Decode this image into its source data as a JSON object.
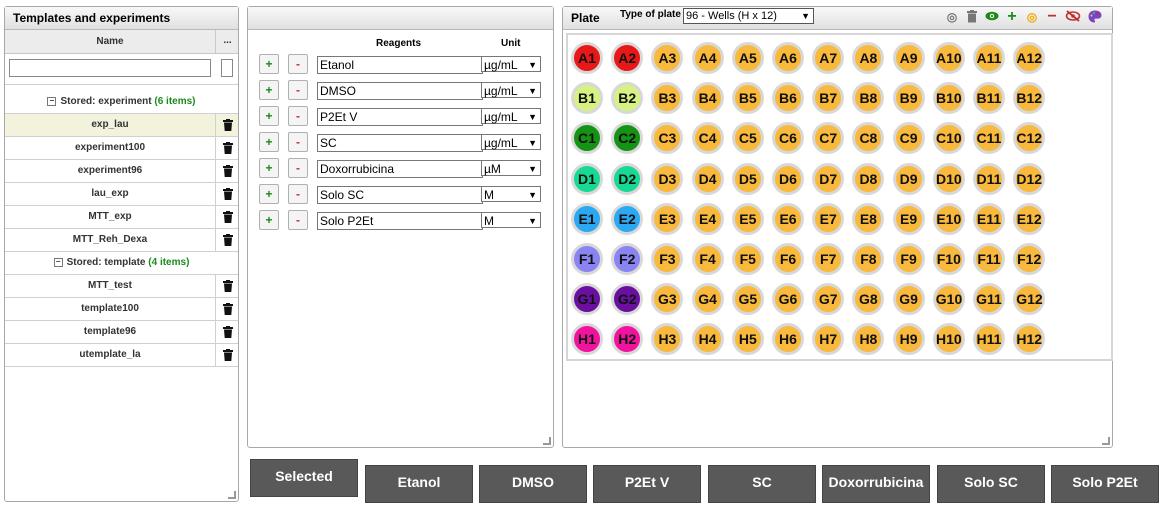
{
  "left_panel": {
    "title": "Templates and experiments",
    "column_name": "Name",
    "column_more": "...",
    "groups": [
      {
        "label": "Stored: experiment",
        "count": "(6 items)",
        "items": [
          "exp_lau",
          "experiment100",
          "experiment96",
          "lau_exp",
          "MTT_exp",
          "MTT_Reh_Dexa"
        ]
      },
      {
        "label": "Stored: template",
        "count": "(4 items)",
        "items": [
          "MTT_test",
          "template100",
          "template96",
          "utemplate_la"
        ]
      }
    ]
  },
  "reagents_panel": {
    "header_reagents": "Reagents",
    "header_unit": "Unit",
    "plus": "+",
    "minus": "-",
    "rows": [
      {
        "name": "Etanol",
        "unit": "µg/mL"
      },
      {
        "name": "DMSO",
        "unit": "µg/mL"
      },
      {
        "name": "P2Et V",
        "unit": "µg/mL"
      },
      {
        "name": "SC",
        "unit": "µg/mL"
      },
      {
        "name": "Doxorrubicina",
        "unit": "µM"
      },
      {
        "name": "Solo SC",
        "unit": "M"
      },
      {
        "name": "Solo P2Et",
        "unit": "M"
      }
    ]
  },
  "plate_panel": {
    "title": "Plate",
    "type_label": "Type of plate",
    "type_value": "96 - Wells (H x 12)",
    "toolbar_icons": [
      "target-icon",
      "trash-icon",
      "eye-icon",
      "plus-icon",
      "circle-icon",
      "minus-icon",
      "eye-off-icon",
      "palette-icon"
    ],
    "rows": [
      "A",
      "B",
      "C",
      "D",
      "E",
      "F",
      "G",
      "H"
    ],
    "cols": [
      1,
      2,
      3,
      4,
      5,
      6,
      7,
      8,
      9,
      10,
      11,
      12
    ],
    "default_color": "#f9b93c",
    "row_colors_col1": [
      "#e81818",
      "#d5f283",
      "#149314",
      "#17d994",
      "#2ba8f2",
      "#8a84f2",
      "#6b0fa1",
      "#f2129d"
    ],
    "row_colors_col2": [
      "#e81818",
      "#d5f283",
      "#149314",
      "#17d994",
      "#2ba8f2",
      "#8a84f2",
      "#6b0fa1",
      "#f2129d"
    ]
  },
  "bottom_buttons": [
    "Selected",
    "Etanol",
    "DMSO",
    "P2Et V",
    "SC",
    "Doxorrubicina",
    "Solo SC",
    "Solo P2Et"
  ],
  "colors": {
    "button_bg": "#595959",
    "selected_row": "#f3f2dc",
    "count_green": "#1a8a1a"
  }
}
